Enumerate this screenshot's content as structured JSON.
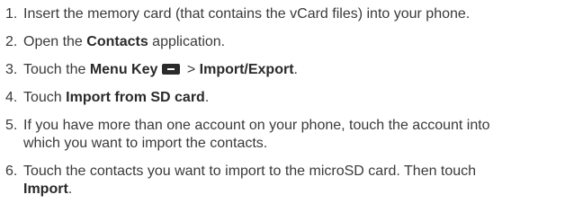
{
  "steps": [
    {
      "num": "1.",
      "text": "Insert the memory card (that contains the vCard files) into your phone."
    },
    {
      "num": "2.",
      "pre": "Open the ",
      "bold": "Contacts",
      "post": " application."
    },
    {
      "num": "3.",
      "pre": "Touch the ",
      "bold1": "Menu Key",
      "icon": "menu-key-icon",
      "sep": " > ",
      "bold2": "Import/Export",
      "post": "."
    },
    {
      "num": "4.",
      "pre": "Touch ",
      "bold": "Import from SD card",
      "post": "."
    },
    {
      "num": "5.",
      "line1": "If you have more than one account on your phone, touch the account into",
      "line2": "which you want to import the contacts."
    },
    {
      "num": "6.",
      "line1": "Touch the contacts you want to import to the microSD card. Then touch",
      "bold": "Import",
      "post": "."
    }
  ]
}
